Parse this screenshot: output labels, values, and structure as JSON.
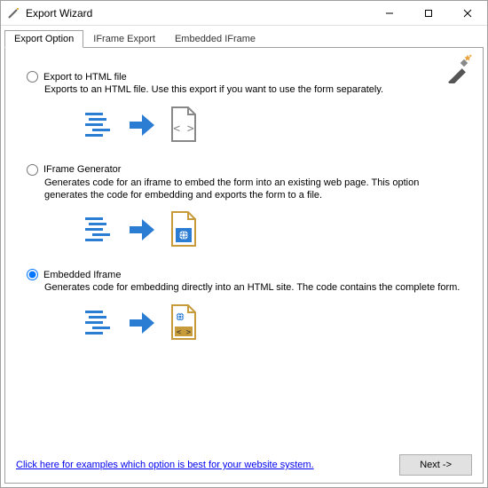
{
  "window": {
    "title": "Export Wizard"
  },
  "tabs": {
    "t0": "Export Option",
    "t1": "IFrame Export",
    "t2": "Embedded IFrame"
  },
  "options": {
    "html": {
      "label": "Export to HTML file",
      "desc": "Exports to an HTML file. Use this export if you want to use the form separately."
    },
    "iframe": {
      "label": "IFrame Generator",
      "desc": "Generates code for an iframe to embed the form into an existing web page. This option generates the code for embedding and exports the form to a file."
    },
    "embedded": {
      "label": "Embedded Iframe",
      "desc": "Generates code for embedding directly into an HTML site. The code contains the complete form."
    }
  },
  "footer": {
    "link": "Click here for examples which option is best for your website system.",
    "next": "Next ->"
  },
  "selected": "embedded"
}
